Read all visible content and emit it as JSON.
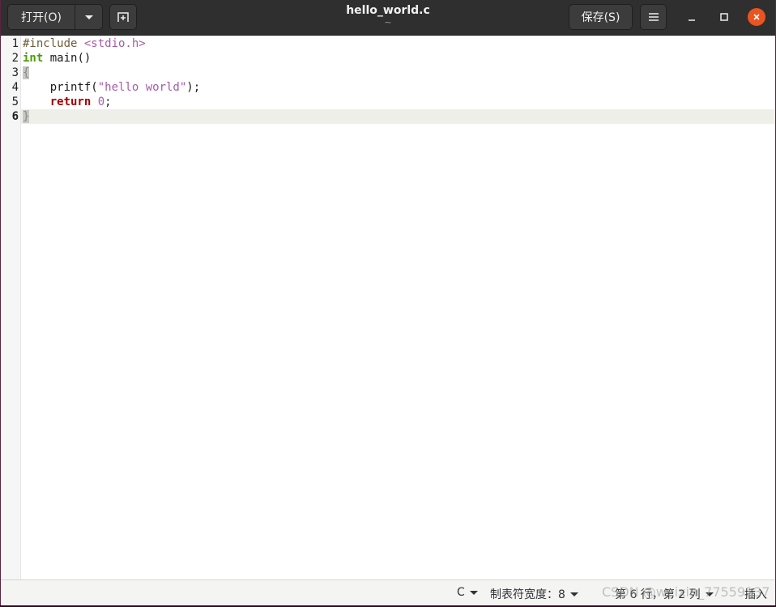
{
  "header": {
    "open_label": "打开(O)",
    "title": "hello_world.c",
    "subtitle": "~",
    "save_label": "保存(S)"
  },
  "editor": {
    "lines": [
      {
        "number": "1",
        "segments": [
          {
            "text": "#include ",
            "cls": "pp"
          },
          {
            "text": "<stdio.h>",
            "cls": "inc"
          }
        ]
      },
      {
        "number": "2",
        "segments": [
          {
            "text": "int",
            "cls": "type"
          },
          {
            "text": " main()",
            "cls": ""
          }
        ]
      },
      {
        "number": "3",
        "segments": [
          {
            "text": "{",
            "cls": "bracket-hl"
          }
        ]
      },
      {
        "number": "4",
        "segments": [
          {
            "text": "    printf(",
            "cls": ""
          },
          {
            "text": "\"hello world\"",
            "cls": "str"
          },
          {
            "text": ");",
            "cls": ""
          }
        ]
      },
      {
        "number": "5",
        "segments": [
          {
            "text": "    ",
            "cls": ""
          },
          {
            "text": "return",
            "cls": "kw"
          },
          {
            "text": " ",
            "cls": ""
          },
          {
            "text": "0",
            "cls": "num"
          },
          {
            "text": ";",
            "cls": ""
          }
        ]
      },
      {
        "number": "6",
        "segments": [
          {
            "text": "}",
            "cls": "bracket-hl"
          }
        ]
      }
    ],
    "current_line": 6
  },
  "statusbar": {
    "language": "C",
    "tab_width": "制表符宽度：8",
    "position": "第 6 行，第 2 列",
    "mode": "插入"
  },
  "watermark": "CSDN @weixin_77559137",
  "colors": {
    "accent_close": "#e95420",
    "header_bg": "#2f2f2f"
  }
}
